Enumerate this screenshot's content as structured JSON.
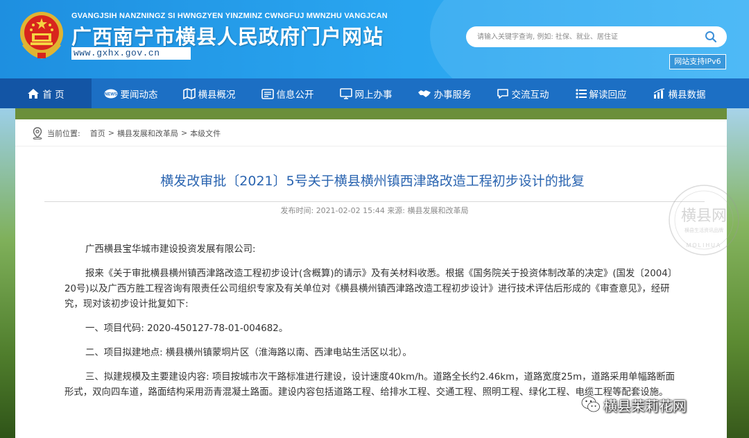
{
  "header": {
    "pinyin": "GVANGJSIH NANZNINGZ SI HWNGZYEN YINZMINZ CWNGFUJ MWNZHU VANGJCAN",
    "site_name": "广西南宁市横县人民政府门户网站",
    "url": "www.gxhx.gov.cn",
    "search_placeholder": "请输入关键字查询, 例如: 社保、就业、居住证",
    "ipv6_label": "网站支持IPv6"
  },
  "nav": {
    "items": [
      {
        "label": "首 页",
        "icon": "home-icon"
      },
      {
        "label": "要闻动态",
        "icon": "news-icon"
      },
      {
        "label": "横县概况",
        "icon": "map-icon"
      },
      {
        "label": "信息公开",
        "icon": "info-icon"
      },
      {
        "label": "网上办事",
        "icon": "monitor-icon"
      },
      {
        "label": "办事服务",
        "icon": "handshake-icon"
      },
      {
        "label": "交流互动",
        "icon": "chat-icon"
      },
      {
        "label": "解读回应",
        "icon": "list-icon"
      },
      {
        "label": "横县数据",
        "icon": "bar-chart-icon"
      }
    ]
  },
  "breadcrumb": {
    "prefix": "当前位置:",
    "items": [
      "首页",
      "横县发展和改革局",
      "本级文件"
    ]
  },
  "article": {
    "title": "横发改审批〔2021〕5号关于横县横州镇西津路改造工程初步设计的批复",
    "time_label": "发布时间:",
    "time_value": "2021-02-02 15:44",
    "source_label": "来源:",
    "source_value": "横县发展和改革局",
    "paragraphs": [
      "广西横县宝华城市建设投资发展有限公司:",
      "报来《关于审批横县横州镇西津路改造工程初步设计(含概算)的请示》及有关材料收悉。根据《国务院关于投资体制改革的决定》(国发〔2004〕20号)以及广西方胜工程咨询有限责任公司组织专家及有关单位对《横县横州镇西津路改造工程初步设计》进行技术评估后形成的《审查意见》，经研究，现对该初步设计批复如下:",
      "一、项目代码: 2020-450127-78-01-004682。",
      "二、项目拟建地点: 横县横州镇蒙垌片区（淮海路以南、西津电站生活区以北）。",
      "三、拟建规模及主要建设内容: 项目按城市次干路标准进行建设，设计速度40km/h。道路全长约2.46km，道路宽度25m，道路采用单幅路断面形式，双向四车道，路面结构采用沥青混凝土路面。建设内容包括道路工程、给排水工程、交通工程、照明工程、绿化工程、电缆工程等配套设施。"
    ]
  },
  "seal_text": "横县网",
  "seal_subtext": "横县生活资讯品牌",
  "seal_arc": "MOLIHUA",
  "watermark": "横县茉莉花网",
  "colors": {
    "header_blue": "#1e8fe0",
    "nav_blue": "#1c6fc4",
    "nav_active": "#1355a5",
    "title_blue": "#2a64b0"
  }
}
